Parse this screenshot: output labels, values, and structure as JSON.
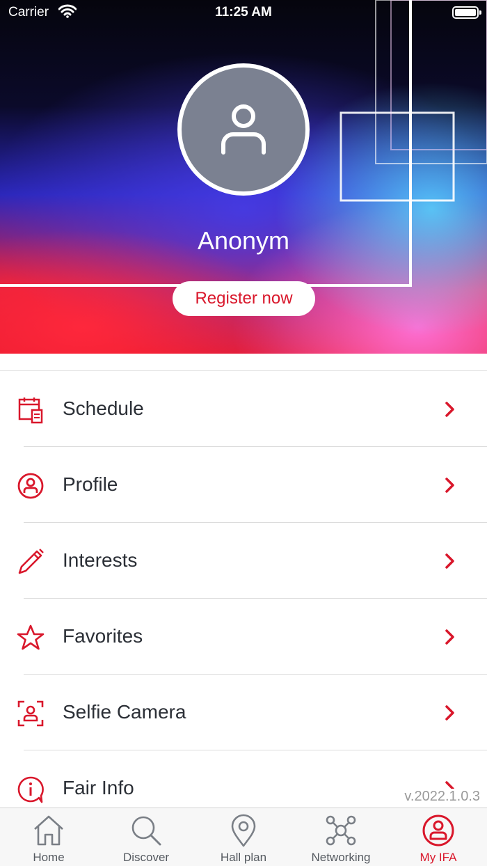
{
  "status_bar": {
    "carrier": "Carrier",
    "time": "11:25 AM"
  },
  "profile": {
    "name": "Anonym",
    "register_label": "Register now"
  },
  "menu": {
    "items": [
      {
        "label": "Schedule",
        "icon": "calendar-icon"
      },
      {
        "label": "Profile",
        "icon": "user-circle-icon"
      },
      {
        "label": "Interests",
        "icon": "pencil-icon"
      },
      {
        "label": "Favorites",
        "icon": "star-icon"
      },
      {
        "label": "Selfie Camera",
        "icon": "selfie-camera-icon"
      },
      {
        "label": "Fair Info",
        "icon": "info-bubble-icon"
      }
    ]
  },
  "version": "v.2022.1.0.3",
  "tabbar": {
    "active": "My IFA",
    "tabs": [
      {
        "label": "Home",
        "icon": "home-icon"
      },
      {
        "label": "Discover",
        "icon": "search-icon"
      },
      {
        "label": "Hall plan",
        "icon": "location-pin-icon"
      },
      {
        "label": "Networking",
        "icon": "network-icon"
      },
      {
        "label": "My IFA",
        "icon": "user-circle-icon"
      }
    ]
  },
  "colors": {
    "accent": "#d9172b",
    "avatar_bg": "#7b8191",
    "text": "#2b2f36",
    "tab_inactive": "#555a60"
  }
}
